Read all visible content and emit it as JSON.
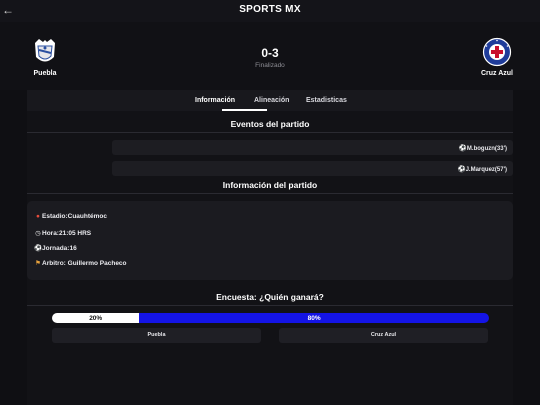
{
  "app": {
    "title": "SPORTS MX",
    "back_icon": "arrow-left-icon"
  },
  "match": {
    "home": {
      "name": "Puebla",
      "crest_icon": "puebla-crest-icon"
    },
    "away": {
      "name": "Cruz Azul",
      "crest_icon": "cruz-azul-crest-icon"
    },
    "score": "0-3",
    "status": "Finalizado"
  },
  "tabs": [
    {
      "label": "Información",
      "active": true
    },
    {
      "label": "Alineación",
      "active": false
    },
    {
      "label": "Estadisticas",
      "active": false
    }
  ],
  "events": {
    "title": "Eventos del partido",
    "items": [
      {
        "icon": "soccer-ball-icon",
        "text": "M.boguzn(33')"
      },
      {
        "icon": "soccer-ball-icon",
        "text": "J.Marquez(57')"
      }
    ]
  },
  "info": {
    "title": "Información del partido",
    "items": [
      {
        "icon": "map-pin-icon",
        "text": "Estadio:Cuauhtémoc"
      },
      {
        "icon": "clock-icon",
        "text": "Hora:21:05 HRS"
      },
      {
        "icon": "soccer-ball-icon",
        "text": "Jornada:16"
      },
      {
        "icon": "referee-icon",
        "text": "Arbitro: Guillermo Pacheco"
      }
    ]
  },
  "poll": {
    "title": "Encuesta: ¿Quién ganará?",
    "home_pct_label": "20%",
    "away_pct_label": "80%",
    "home_fraction": 0.2,
    "away_fraction": 0.8,
    "home_color": "#ffffff",
    "away_color": "#1414e6",
    "home_button": "Puebla",
    "away_button": "Cruz Azul"
  }
}
